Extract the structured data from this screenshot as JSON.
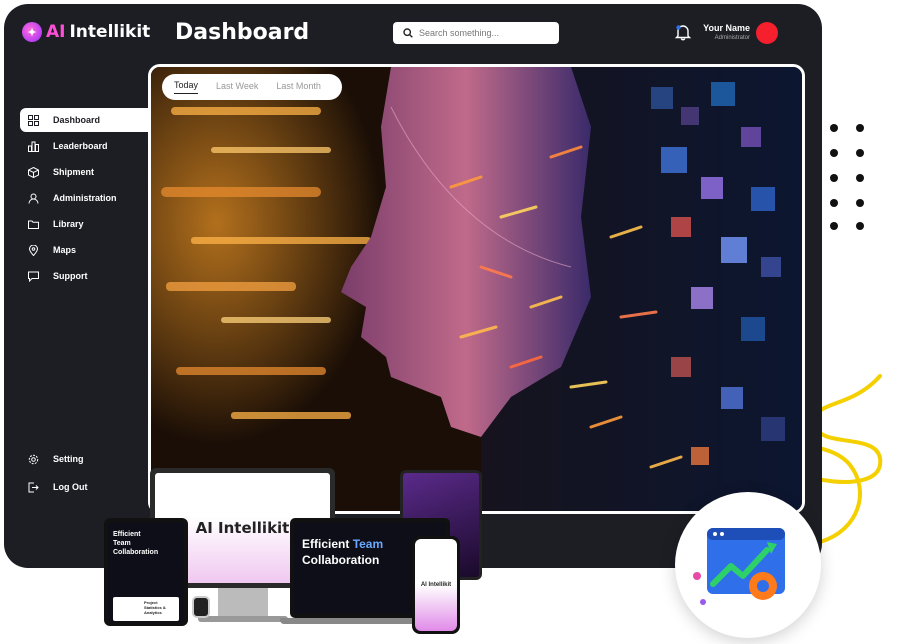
{
  "app": {
    "logo_ai": "AI",
    "logo_name": "Intellikit",
    "page_title": "Dashboard"
  },
  "search": {
    "placeholder": "Search something..."
  },
  "user": {
    "name": "Your Name",
    "role": "Administrator"
  },
  "tabs": [
    {
      "label": "Today",
      "active": true
    },
    {
      "label": "Last Week",
      "active": false
    },
    {
      "label": "Last Month",
      "active": false
    }
  ],
  "sidebar": {
    "items": [
      {
        "label": "Dashboard",
        "icon": "dashboard-icon"
      },
      {
        "label": "Leaderboard",
        "icon": "leaderboard-icon"
      },
      {
        "label": "Shipment",
        "icon": "box-icon"
      },
      {
        "label": "Administration",
        "icon": "user-icon"
      },
      {
        "label": "Library",
        "icon": "folder-icon"
      },
      {
        "label": "Maps",
        "icon": "map-pin-icon"
      },
      {
        "label": "Support",
        "icon": "chat-icon"
      }
    ],
    "bottom": [
      {
        "label": "Setting",
        "icon": "gear-icon"
      },
      {
        "label": "Log Out",
        "icon": "logout-icon"
      }
    ]
  },
  "mockups": {
    "monitor_logo": "AI Intellikit",
    "laptop_headline_1": "Efficient",
    "laptop_headline_1_accent": "Team",
    "laptop_headline_2": "Collaboration",
    "tablet_headline": "Efficient Team Collaboration",
    "tablet_subhead": "Project Statistics & Analytics",
    "phone_logo": "AI Intellikit"
  },
  "colors": {
    "panel": "#1d1e24",
    "accent_pink": "#ff4fd8",
    "avatar": "#f51f2d",
    "squiggle": "#f5d000",
    "accent_blue": "#2f6fea"
  }
}
